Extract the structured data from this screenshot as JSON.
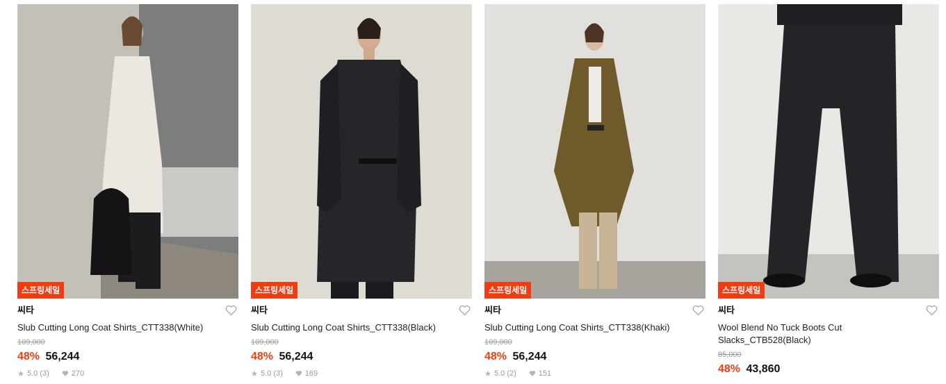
{
  "products": [
    {
      "badge": "스프링세일",
      "brand": "씨타",
      "name": "Slub Cutting Long Coat Shirts_CTT338(White)",
      "original_price": "109,000",
      "discount": "48%",
      "price": "56,244",
      "rating": "5.0 (3)",
      "likes": "270",
      "colors": {
        "bg": "#c9c6be",
        "garment": "#ece8df",
        "pants": "#1c1c1e"
      }
    },
    {
      "badge": "스프링세일",
      "brand": "씨타",
      "name": "Slub Cutting Long Coat Shirts_CTT338(Black)",
      "original_price": "109,000",
      "discount": "48%",
      "price": "56,244",
      "rating": "5.0 (3)",
      "likes": "169",
      "colors": {
        "bg": "#dedbd3",
        "garment": "#26252a",
        "pants": "#1b1a1f"
      }
    },
    {
      "badge": "스프링세일",
      "brand": "씨타",
      "name": "Slub Cutting Long Coat Shirts_CTT338(Khaki)",
      "original_price": "109,000",
      "discount": "48%",
      "price": "56,244",
      "rating": "5.0 (2)",
      "likes": "151",
      "colors": {
        "bg": "#e2e0dc",
        "garment": "#6f5a2a",
        "pants": "#c8b496"
      }
    },
    {
      "badge": "스프링세일",
      "brand": "씨타",
      "name": "Wool Blend No Tuck Boots Cut Slacks_CTB528(Black)",
      "original_price": "85,000",
      "discount": "48%",
      "price": "43,860",
      "rating": "",
      "likes": "",
      "colors": {
        "bg": "#e9e8e4",
        "garment": "#232427",
        "pants": "#232427"
      }
    }
  ],
  "icons": {
    "wishlist": "heart-outline-icon",
    "rating": "star-icon",
    "likes": "heart-filled-icon"
  },
  "accent_color": "#ef3e12"
}
